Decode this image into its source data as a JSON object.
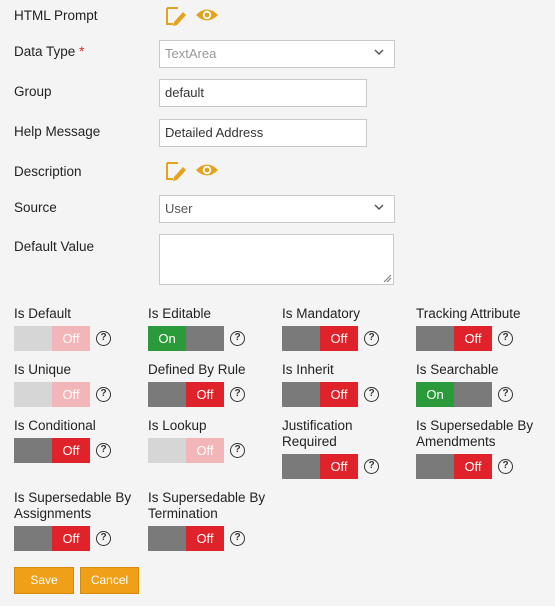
{
  "form": {
    "html_prompt_label": "HTML Prompt",
    "data_type_label": "Data Type",
    "required_mark": "*",
    "data_type_value": "TextArea",
    "group_label": "Group",
    "group_value": "default",
    "help_message_label": "Help Message",
    "help_message_value": "Detailed Address",
    "description_label": "Description",
    "source_label": "Source",
    "source_value": "User",
    "default_value_label": "Default Value",
    "default_value_value": ""
  },
  "icons": {
    "edit": "edit-icon",
    "preview": "eye-icon",
    "chevron": "chevron-down-icon",
    "help": "help-icon"
  },
  "colors": {
    "accent": "#f0a018",
    "on": "#2a9a3a",
    "off": "#e0232a",
    "toggle_grey": "#7a7a7a",
    "icon_orange": "#e2a21e"
  },
  "help_glyph": "?",
  "toggles": [
    {
      "label": "Is Default",
      "text": "Off",
      "state": "off",
      "disabled": true
    },
    {
      "label": "Is Editable",
      "text": "On",
      "state": "on",
      "disabled": false
    },
    {
      "label": "Is Mandatory",
      "text": "Off",
      "state": "off",
      "disabled": false
    },
    {
      "label": "Tracking Attribute",
      "text": "Off",
      "state": "off",
      "disabled": false
    },
    {
      "label": "Is Unique",
      "text": "Off",
      "state": "off",
      "disabled": true
    },
    {
      "label": "Defined By Rule",
      "text": "Off",
      "state": "off",
      "disabled": false
    },
    {
      "label": "Is Inherit",
      "text": "Off",
      "state": "off",
      "disabled": false
    },
    {
      "label": "Is Searchable",
      "text": "On",
      "state": "on",
      "disabled": false
    },
    {
      "label": "Is Conditional",
      "text": "Off",
      "state": "off",
      "disabled": false
    },
    {
      "label": "Is Lookup",
      "text": "Off",
      "state": "off",
      "disabled": true
    },
    {
      "label_line1": "Justification",
      "label_line2": "Required",
      "text": "Off",
      "state": "off",
      "disabled": false
    },
    {
      "label_line1": "Is Supersedable By",
      "label_line2": "Amendments",
      "text": "Off",
      "state": "off",
      "disabled": false
    },
    {
      "label_line1": "Is Supersedable By",
      "label_line2": "Assignments",
      "text": "Off",
      "state": "off",
      "disabled": false
    },
    {
      "label_line1": "Is Supersedable By",
      "label_line2": "Termination",
      "text": "Off",
      "state": "off",
      "disabled": false
    }
  ],
  "buttons": {
    "save": "Save",
    "cancel": "Cancel"
  }
}
